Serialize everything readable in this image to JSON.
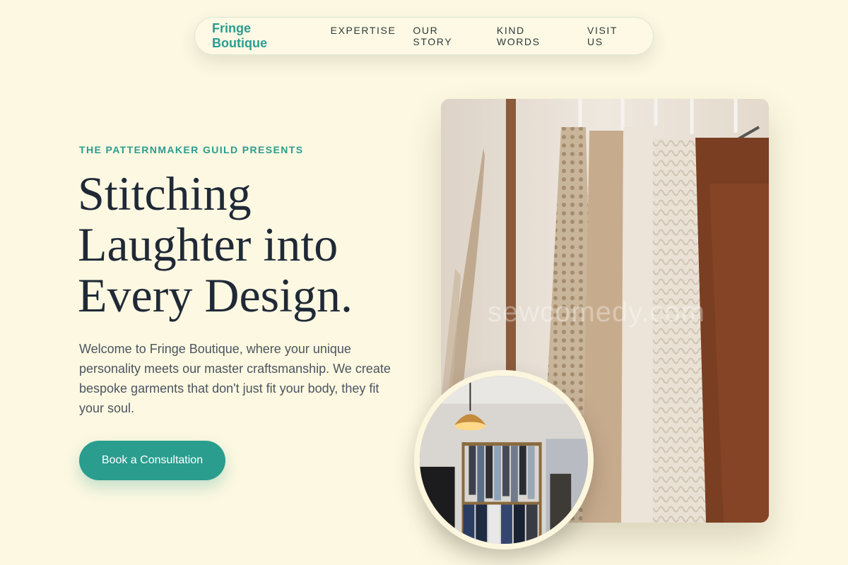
{
  "nav": {
    "brand": "Fringe Boutique",
    "links": [
      "EXPERTISE",
      "OUR STORY",
      "KIND WORDS",
      "VISIT US"
    ]
  },
  "hero": {
    "eyebrow": "THE PATTERNMAKER GUILD PRESENTS",
    "headline": "Stitching Laughter into Every Design.",
    "lede": "Welcome to Fringe Boutique, where your unique personality meets our master craftsmanship. We create bespoke garments that don't just fit your body, they fit your soul.",
    "cta_label": "Book a Consultation"
  },
  "photos": {
    "main_watermark": "sewcomedy.com"
  },
  "colors": {
    "background": "#fdf8e1",
    "accent": "#2a9d8f",
    "heading": "#1f2937",
    "body_text": "#4b5560"
  }
}
